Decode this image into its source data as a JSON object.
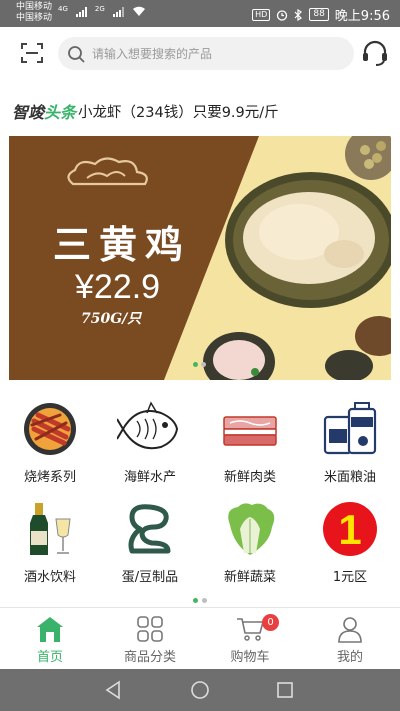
{
  "status_bar": {
    "carrier1": "中国移动",
    "carrier2": "中国移动",
    "net1": "4G",
    "net2": "2G",
    "hd": "HD",
    "battery": "88",
    "time": "晚上9:56"
  },
  "search": {
    "placeholder": "请输入想要搜索的产品"
  },
  "headline": {
    "brand_part1": "智竣",
    "brand_part2": "头条",
    "text": "小龙虾（234钱）只要9.9元/斤"
  },
  "banner": {
    "title": "三黄鸡",
    "price": "¥22.9",
    "unit": "750G/只",
    "slide_index": 0,
    "slide_count": 2
  },
  "categories": [
    {
      "label": "烧烤系列",
      "icon": "bbq-grill-icon"
    },
    {
      "label": "海鲜水产",
      "icon": "fish-icon"
    },
    {
      "label": "新鲜肉类",
      "icon": "meat-icon"
    },
    {
      "label": "米面粮油",
      "icon": "grain-oil-icon"
    },
    {
      "label": "酒水饮料",
      "icon": "wine-bottle-icon"
    },
    {
      "label": "蛋/豆制品",
      "icon": "egg-tofu-icon"
    },
    {
      "label": "新鲜蔬菜",
      "icon": "cabbage-icon"
    },
    {
      "label": "1元区",
      "icon": "one-yuan-icon",
      "badge_text": "1"
    }
  ],
  "category_pager": {
    "current": 0,
    "count": 2
  },
  "tabs": [
    {
      "label": "首页",
      "icon": "home-icon",
      "active": true
    },
    {
      "label": "商品分类",
      "icon": "category-grid-icon",
      "active": false
    },
    {
      "label": "购物车",
      "icon": "cart-icon",
      "active": false,
      "badge": "0"
    },
    {
      "label": "我的",
      "icon": "user-icon",
      "active": false
    }
  ],
  "colors": {
    "accent": "#39b36a",
    "badge": "#e84040",
    "banner_brown": "#7a4a20",
    "banner_yellow": "#f5e3a2"
  }
}
